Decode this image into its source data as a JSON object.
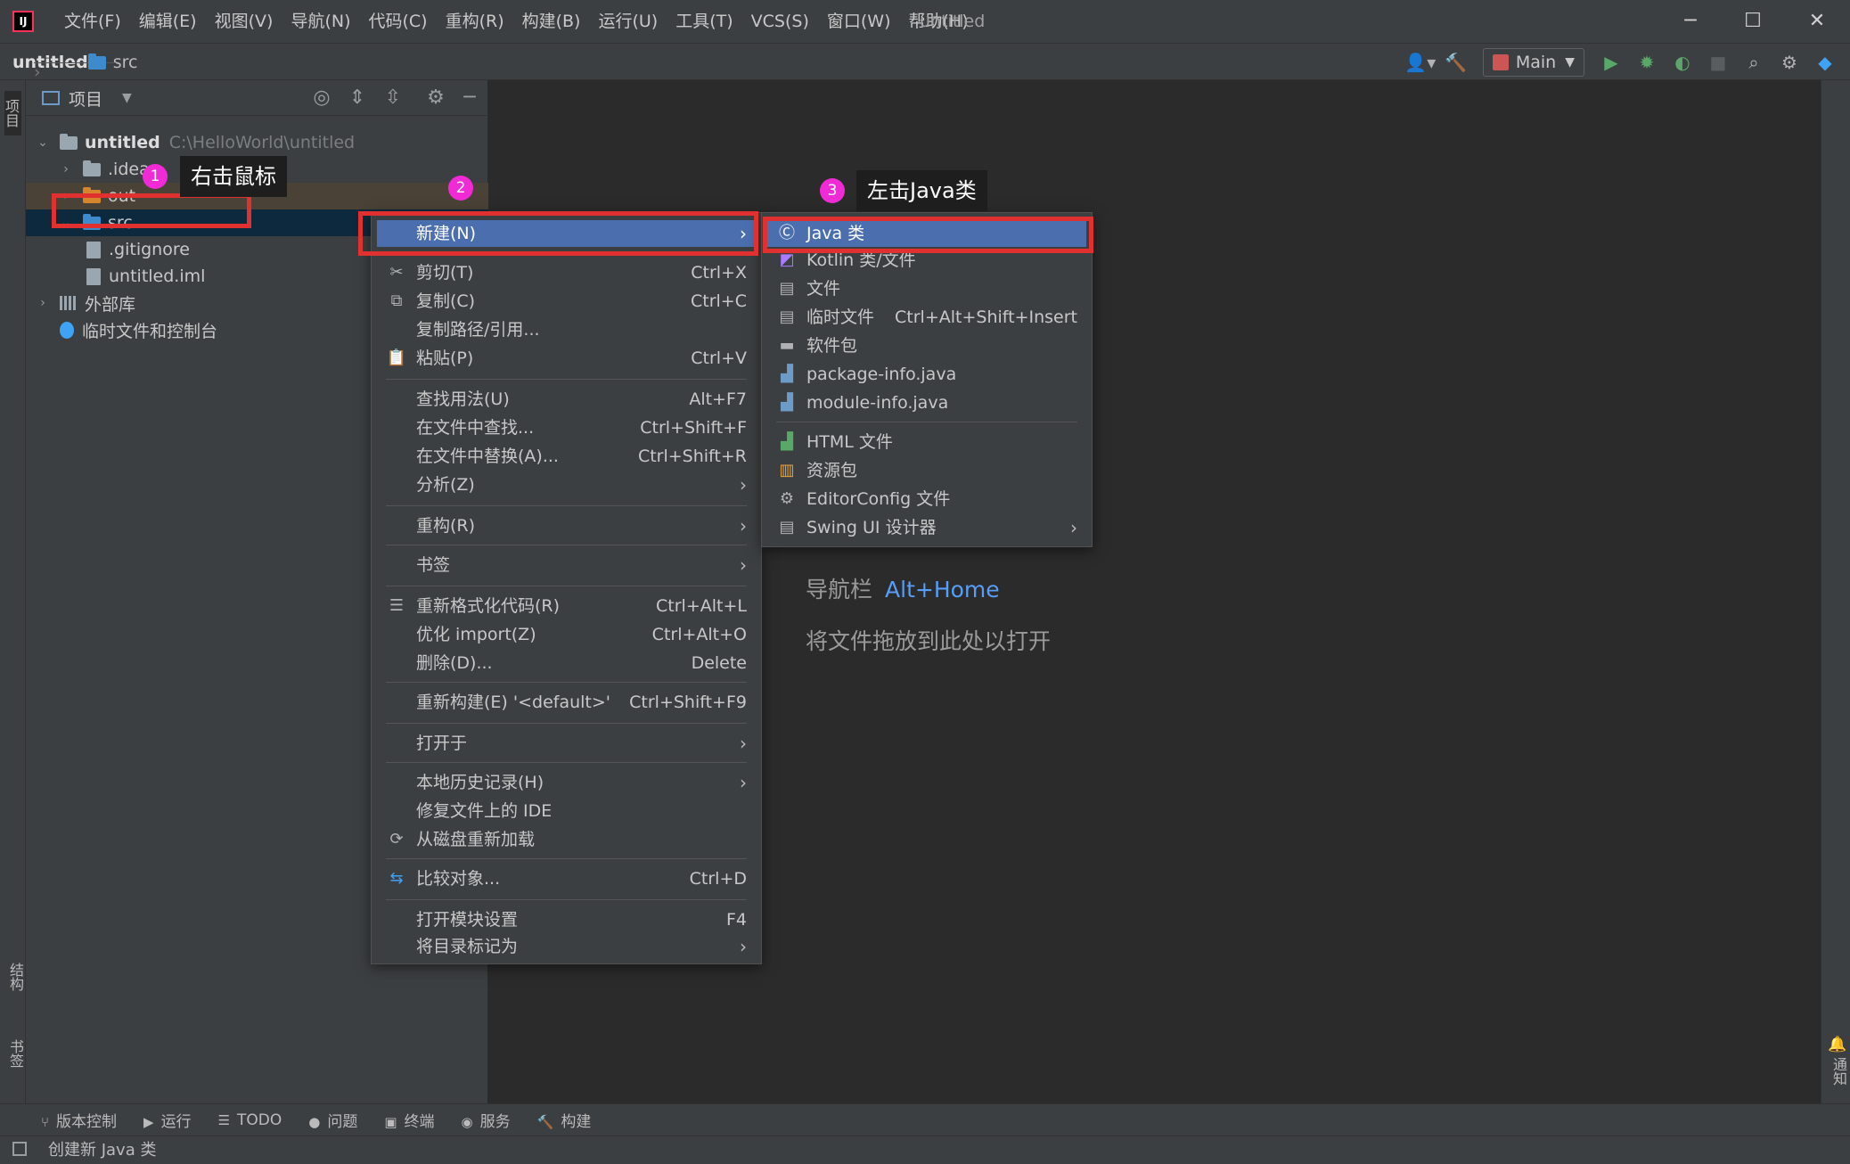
{
  "titlebar": {
    "logo": "IJ",
    "menus": [
      "文件(F)",
      "编辑(E)",
      "视图(V)",
      "导航(N)",
      "代码(C)",
      "重构(R)",
      "构建(B)",
      "运行(U)",
      "工具(T)",
      "VCS(S)",
      "窗口(W)",
      "帮助(H)"
    ],
    "window_title": "untitled",
    "minimize": "─",
    "maximize": "☐",
    "close": "✕"
  },
  "navbar": {
    "project": "untitled",
    "folder": "src",
    "run_config": "Main"
  },
  "left_stripe": {
    "project_tab": "项目",
    "structure_tab": "结构",
    "bookmarks_tab": "书签"
  },
  "right_stripe": {
    "notifications_tab": "通知"
  },
  "project_panel": {
    "title": "项目",
    "tree": {
      "root_name": "untitled",
      "root_path": "C:\\HelloWorld\\untitled",
      "idea": ".idea",
      "out": "out",
      "src": "src",
      "gitignore": ".gitignore",
      "iml": "untitled.iml",
      "external_libs": "外部库",
      "scratches": "临时文件和控制台"
    }
  },
  "editor": {
    "nav_hint": "导航栏",
    "nav_key": "Alt+Home",
    "drop_hint": "将文件拖放到此处以打开"
  },
  "context_menu": {
    "new": "新建(N)",
    "cut": "剪切(T)",
    "cut_sc": "Ctrl+X",
    "copy": "复制(C)",
    "copy_sc": "Ctrl+C",
    "copy_path": "复制路径/引用...",
    "paste": "粘贴(P)",
    "paste_sc": "Ctrl+V",
    "find_usages": "查找用法(U)",
    "find_usages_sc": "Alt+F7",
    "find_in_files": "在文件中查找...",
    "find_in_files_sc": "Ctrl+Shift+F",
    "replace_in_files": "在文件中替换(A)...",
    "replace_in_files_sc": "Ctrl+Shift+R",
    "analyze": "分析(Z)",
    "refactor": "重构(R)",
    "bookmarks": "书签",
    "reformat": "重新格式化代码(R)",
    "reformat_sc": "Ctrl+Alt+L",
    "optimize_imports": "优化 import(Z)",
    "optimize_imports_sc": "Ctrl+Alt+O",
    "delete": "删除(D)...",
    "delete_sc": "Delete",
    "rebuild": "重新构建(E) '<default>'",
    "rebuild_sc": "Ctrl+Shift+F9",
    "open_in": "打开于",
    "local_history": "本地历史记录(H)",
    "repair_ide": "修复文件上的 IDE",
    "reload_disk": "从磁盘重新加载",
    "compare": "比较对象...",
    "compare_sc": "Ctrl+D",
    "module_settings": "打开模块设置",
    "module_settings_sc": "F4",
    "mark_dir": "将目录标记为"
  },
  "submenu": {
    "java_class": "Java 类",
    "kotlin": "Kotlin 类/文件",
    "file": "文件",
    "scratch": "临时文件",
    "scratch_sc": "Ctrl+Alt+Shift+Insert",
    "package": "软件包",
    "package_info": "package-info.java",
    "module_info": "module-info.java",
    "html": "HTML 文件",
    "resource_bundle": "资源包",
    "editorconfig": "EditorConfig 文件",
    "swing": "Swing UI 设计器"
  },
  "annotations": {
    "b1": "1",
    "c1": "右击鼠标",
    "b2": "2",
    "b3": "3",
    "c3": "左击Java类"
  },
  "bottom_tabs": [
    "版本控制",
    "运行",
    "TODO",
    "问题",
    "终端",
    "服务",
    "构建"
  ],
  "status": "创建新 Java 类",
  "colors": {
    "selection": "#4b6eaf",
    "annotation_red": "#e03030",
    "badge": "#f02bd6",
    "link": "#589df6"
  }
}
